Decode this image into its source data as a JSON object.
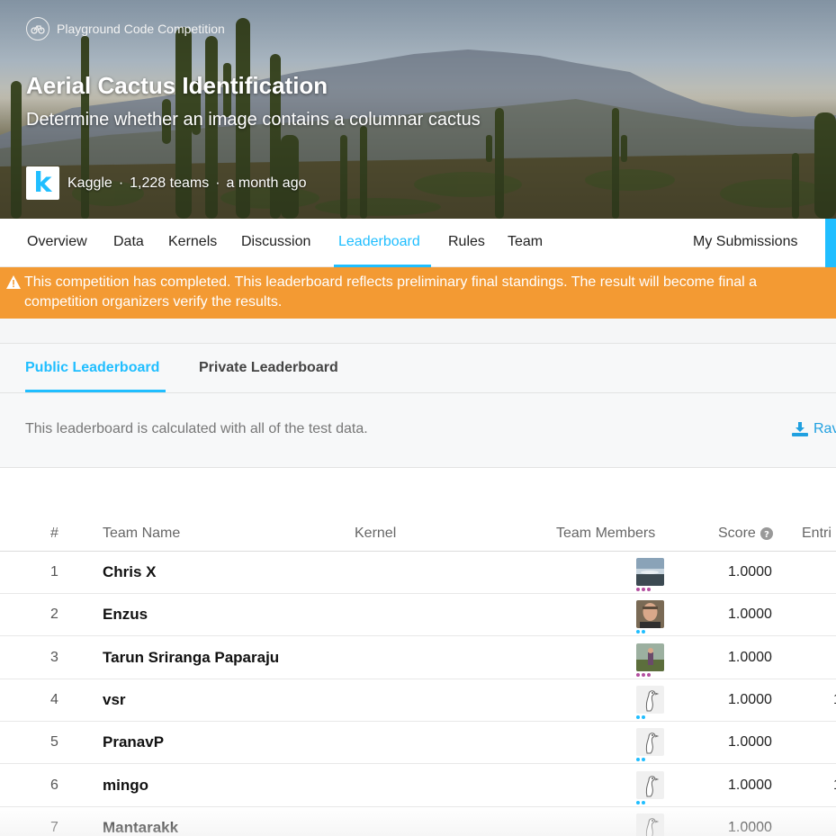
{
  "hero": {
    "competition_type": "Playground Code Competition",
    "title": "Aerial Cactus Identification",
    "subtitle": "Determine whether an image contains a columnar cactus",
    "host_logo": "k",
    "host": "Kaggle",
    "teams": "1,228 teams",
    "time": "a month ago"
  },
  "nav": {
    "tabs": [
      "Overview",
      "Data",
      "Kernels",
      "Discussion",
      "Leaderboard",
      "Rules",
      "Team"
    ],
    "active": "Leaderboard",
    "my_submissions": "My Submissions"
  },
  "banner": {
    "line1": "This competition has completed. This leaderboard reflects preliminary final standings. The result will become final a",
    "line2": "competition organizers verify the results.",
    "color": "#f39a33"
  },
  "leaderboard": {
    "tabs": [
      "Public Leaderboard",
      "Private Leaderboard"
    ],
    "active": "Public Leaderboard",
    "note": "This leaderboard is calculated with all of the test data.",
    "raw_link": "Rav",
    "columns": [
      "#",
      "Team Name",
      "Kernel",
      "Team Members",
      "Score",
      "Entri"
    ],
    "rows": [
      {
        "rank": "1",
        "team": "Chris X",
        "score": "1.0000",
        "entries": "",
        "avatar": "photo-landscape",
        "tier": "master"
      },
      {
        "rank": "2",
        "team": "Enzus",
        "score": "1.0000",
        "entries": "",
        "avatar": "photo-person",
        "tier": "expert"
      },
      {
        "rank": "3",
        "team": "Tarun Sriranga Paparaju",
        "score": "1.0000",
        "entries": "",
        "avatar": "photo-landscape-person",
        "tier": "master"
      },
      {
        "rank": "4",
        "team": "vsr",
        "score": "1.0000",
        "entries": "1",
        "avatar": "default-ostrich",
        "tier": "expert"
      },
      {
        "rank": "5",
        "team": "PranavP",
        "score": "1.0000",
        "entries": "",
        "avatar": "default-ostrich",
        "tier": "expert"
      },
      {
        "rank": "6",
        "team": "mingo",
        "score": "1.0000",
        "entries": "1",
        "avatar": "default-ostrich",
        "tier": "expert"
      },
      {
        "rank": "7",
        "team": "Mantarakk",
        "score": "1.0000",
        "entries": "",
        "avatar": "default-ostrich",
        "tier": "none"
      }
    ]
  },
  "colors": {
    "accent": "#20beff",
    "master_tier": "#b44fa0",
    "expert_tier": "#20beff"
  }
}
